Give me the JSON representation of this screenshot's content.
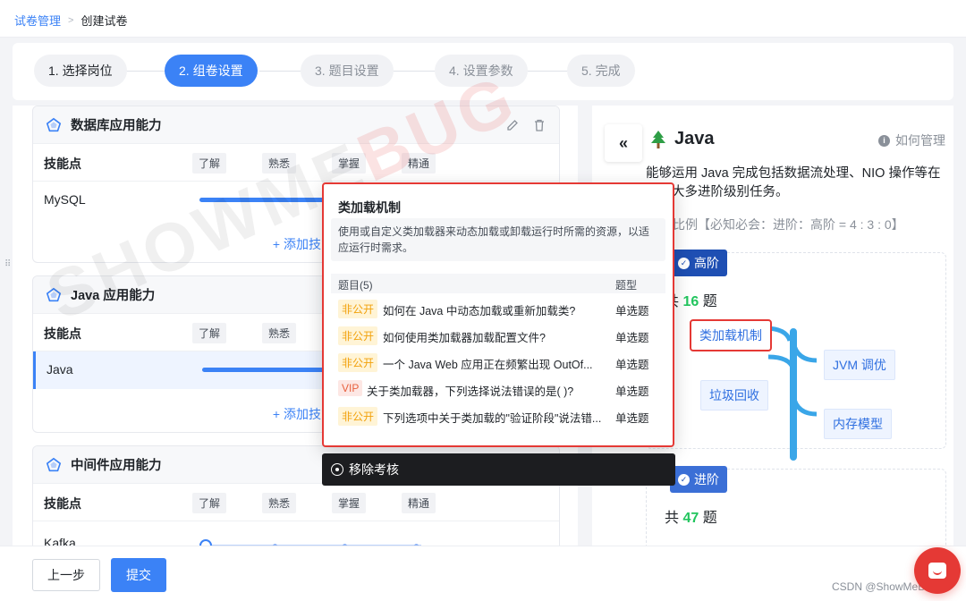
{
  "breadcrumb": {
    "parent": "试卷管理",
    "separator": ">",
    "current": "创建试卷"
  },
  "steps": [
    {
      "label": "1. 选择岗位",
      "state": "done"
    },
    {
      "label": "2. 组卷设置",
      "state": "active"
    },
    {
      "label": "3. 题目设置",
      "state": "pending"
    },
    {
      "label": "4. 设置参数",
      "state": "pending"
    },
    {
      "label": "5. 完成",
      "state": "pending"
    }
  ],
  "cards": [
    {
      "title": "数据库应用能力",
      "skill_header": "技能点",
      "levels": [
        "了解",
        "熟悉",
        "掌握",
        "精通"
      ],
      "rows": [
        "MySQL"
      ],
      "add_label": "+ 添加技能",
      "actions": [
        "edit-icon",
        "delete-icon"
      ]
    },
    {
      "title": "Java 应用能力",
      "skill_header": "技能点",
      "levels": [
        "了解",
        "熟悉",
        "掌握",
        "精通"
      ],
      "rows": [
        "Java"
      ],
      "add_label": "+ 添加技能"
    },
    {
      "title": "中间件应用能力",
      "skill_header": "技能点",
      "levels": [
        "了解",
        "熟悉",
        "掌握",
        "精通"
      ],
      "rows": [
        "Kafka"
      ]
    }
  ],
  "right_panel": {
    "collapse_label": "«",
    "title": "Java",
    "help_label": "如何管理",
    "description": "能够运用 Java 完成包括数据流处理、NIO 操作等在内的大多进阶级别任务。",
    "ratio": "比例【必知必会：进阶：高阶 = 4 : 3 : 0】",
    "advanced": {
      "tag": "高阶",
      "count_prefix": "共",
      "count": "16",
      "count_suffix": "题",
      "nodes": [
        "类加载机制",
        "JVM 调优",
        "垃圾回收",
        "内存模型"
      ]
    },
    "intermediate": {
      "tag": "进阶",
      "count_prefix": "共",
      "count": "47",
      "count_suffix": "题"
    }
  },
  "popover": {
    "title": "类加载机制",
    "description": "使用或自定义类加载器来动态加载或卸载运行时所需的资源，以适应运行时需求。",
    "col_question": "题目(5)",
    "col_type": "题型",
    "rows": [
      {
        "badge": "非公开",
        "badge_kind": "private",
        "text": "如何在 Java 中动态加载或重新加载类?",
        "type": "单选题"
      },
      {
        "badge": "非公开",
        "badge_kind": "private",
        "text": "如何使用类加载器加载配置文件?",
        "type": "单选题"
      },
      {
        "badge": "非公开",
        "badge_kind": "private",
        "text": "一个 Java Web 应用正在频繁出现 OutOf...",
        "type": "单选题"
      },
      {
        "badge": "VIP",
        "badge_kind": "vip",
        "text": "关于类加载器，下列选择说法错误的是( )?",
        "type": "单选题"
      },
      {
        "badge": "非公开",
        "badge_kind": "private",
        "text": "下列选项中关于类加载的\"验证阶段\"说法错...",
        "type": "单选题"
      }
    ],
    "remove_label": "移除考核"
  },
  "watermark": {
    "main": "SHOWME",
    "accent": "BUG"
  },
  "footer": {
    "prev_label": "上一步",
    "submit_label": "提交",
    "credit": "CSDN @ShowMeBug"
  },
  "colors": {
    "primary": "#3b82f6",
    "highlight": "#e53935",
    "count": "#22c55e",
    "spine": "#3aa6e8"
  }
}
